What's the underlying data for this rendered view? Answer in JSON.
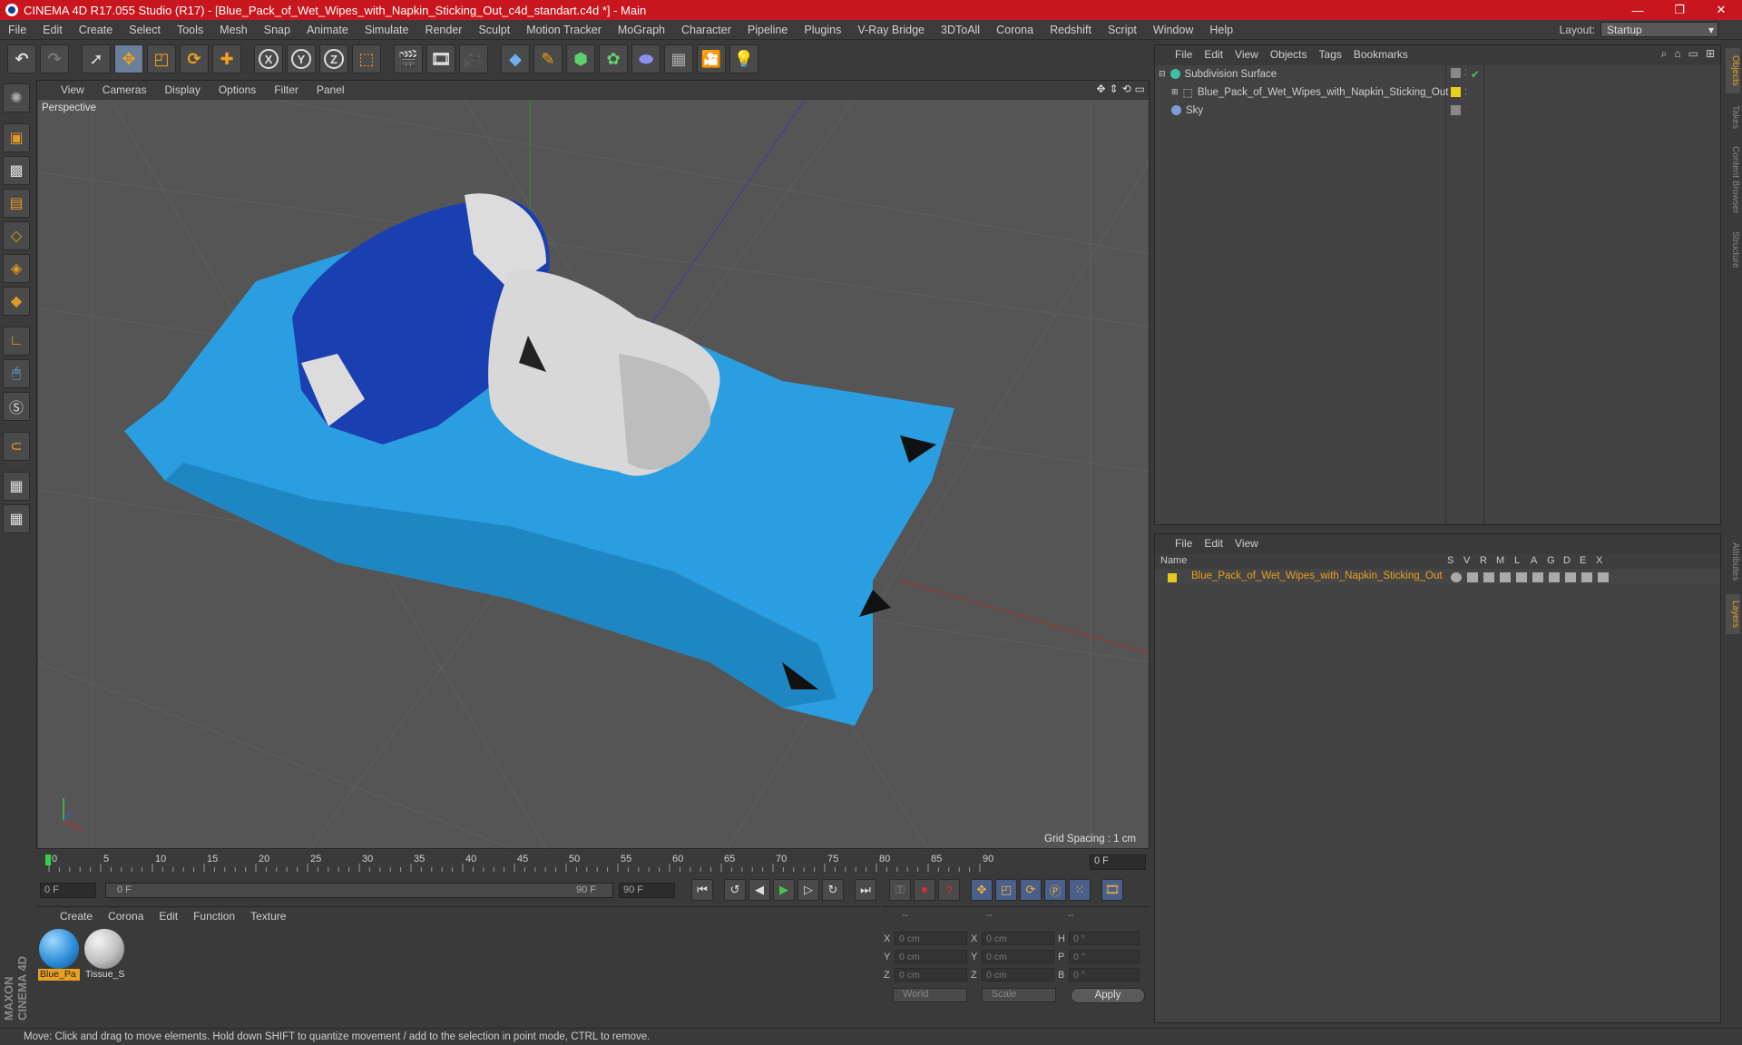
{
  "titlebar": {
    "title": "CINEMA 4D R17.055 Studio (R17) - [Blue_Pack_of_Wet_Wipes_with_Napkin_Sticking_Out_c4d_standart.c4d *] - Main",
    "minimize": "—",
    "maximize": "❐",
    "close": "✕"
  },
  "menu": [
    "File",
    "Edit",
    "Create",
    "Select",
    "Tools",
    "Mesh",
    "Snap",
    "Animate",
    "Simulate",
    "Render",
    "Sculpt",
    "Motion Tracker",
    "MoGraph",
    "Character",
    "Pipeline",
    "Plugins",
    "V-Ray Bridge",
    "3DToAll",
    "Corona",
    "Redshift",
    "Script",
    "Window",
    "Help"
  ],
  "layout": {
    "label": "Layout:",
    "value": "Startup"
  },
  "toolbar": {
    "x_label": "X",
    "y_label": "Y",
    "z_label": "Z"
  },
  "viewport": {
    "menu": [
      "View",
      "Cameras",
      "Display",
      "Options",
      "Filter",
      "Panel"
    ],
    "label": "Perspective",
    "grid_spacing": "Grid Spacing : 1 cm"
  },
  "timeline": {
    "ticks": [
      "0",
      "5",
      "10",
      "15",
      "20",
      "25",
      "30",
      "35",
      "40",
      "45",
      "50",
      "55",
      "60",
      "65",
      "70",
      "75",
      "80",
      "85",
      "90"
    ],
    "current_frame": "0 F"
  },
  "playbar": {
    "start": "0 F",
    "range_start": "0 F",
    "range_end": "90 F",
    "end": "90 F"
  },
  "materials": {
    "menu": [
      "Create",
      "Corona",
      "Edit",
      "Function",
      "Texture"
    ],
    "items": [
      {
        "label": "Blue_Pa",
        "color": "#2f8fd8"
      },
      {
        "label": "Tissue_S",
        "color": "#bdbdbd"
      }
    ]
  },
  "coords": {
    "headers": [
      "--",
      "--",
      "--"
    ],
    "rows": [
      {
        "a": "X",
        "av": "0 cm",
        "b": "X",
        "bv": "0 cm",
        "c": "H",
        "cv": "0 °"
      },
      {
        "a": "Y",
        "av": "0 cm",
        "b": "Y",
        "bv": "0 cm",
        "c": "P",
        "cv": "0 °"
      },
      {
        "a": "Z",
        "av": "0 cm",
        "b": "Z",
        "bv": "0 cm",
        "c": "B",
        "cv": "0 °"
      }
    ],
    "world": "World",
    "scale": "Scale",
    "apply": "Apply"
  },
  "status": "Move: Click and drag to move elements. Hold down SHIFT to quantize movement / add to the selection in point mode, CTRL to remove.",
  "objects": {
    "menu": [
      "File",
      "Edit",
      "View",
      "Objects",
      "Tags",
      "Bookmarks"
    ],
    "items": [
      {
        "name": "Subdivision Surface",
        "icon_color": "#3cc0a0"
      },
      {
        "name": "Blue_Pack_of_Wet_Wipes_with_Napkin_Sticking_Out",
        "icon_color": "#bbbbbb"
      },
      {
        "name": "Sky",
        "icon_color": "#7a9ed8"
      }
    ]
  },
  "layers": {
    "menu": [
      "File",
      "Edit",
      "View"
    ],
    "columns": [
      "Name",
      "S",
      "V",
      "R",
      "M",
      "L",
      "A",
      "G",
      "D",
      "E",
      "X"
    ],
    "row": "Blue_Pack_of_Wet_Wipes_with_Napkin_Sticking_Out",
    "row_color": "#e8c820"
  },
  "right_tabs": [
    "Objects",
    "Takes",
    "Content Browser",
    "Structure",
    "Attributes",
    "Layers"
  ],
  "brand": "MAXON CINEMA 4D"
}
